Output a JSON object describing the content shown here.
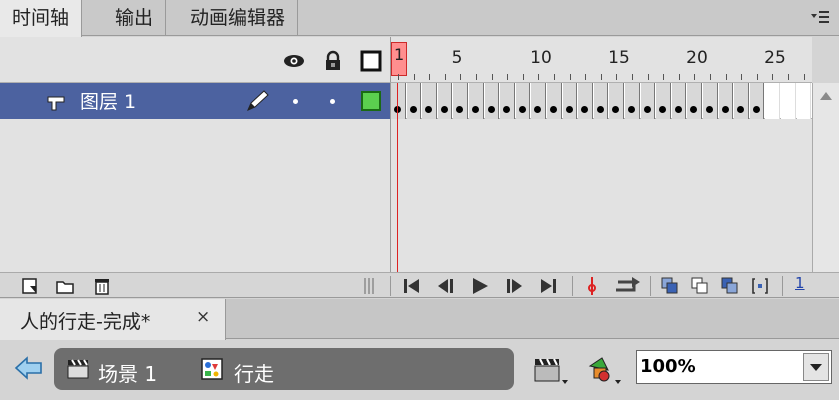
{
  "panel_tabs": [
    {
      "label": "时间轴",
      "active": true
    },
    {
      "label": "输出",
      "active": false
    },
    {
      "label": "动画编辑器",
      "active": false
    }
  ],
  "header_icons": [
    "eye-icon",
    "lock-icon",
    "outline-square-icon"
  ],
  "ruler": {
    "labels": [
      "5",
      "10",
      "15",
      "20",
      "25"
    ],
    "current_frame": "1"
  },
  "layer": {
    "name": "图层 1",
    "keyframe_count": 24,
    "total_frame_columns": 28,
    "outline_color": "#5bcf4f",
    "selected_color": "#4c62a0"
  },
  "timeline_toolbar": {
    "frame_count": "1"
  },
  "document_tab": {
    "title": "人的行走-完成*",
    "close_glyph": "×"
  },
  "breadcrumb": {
    "scene_label": "场景 1",
    "symbol_label": "行走"
  },
  "zoom": {
    "value": "100%"
  },
  "colors": {
    "playhead": "#d22222",
    "accent": "#4c62a0"
  }
}
